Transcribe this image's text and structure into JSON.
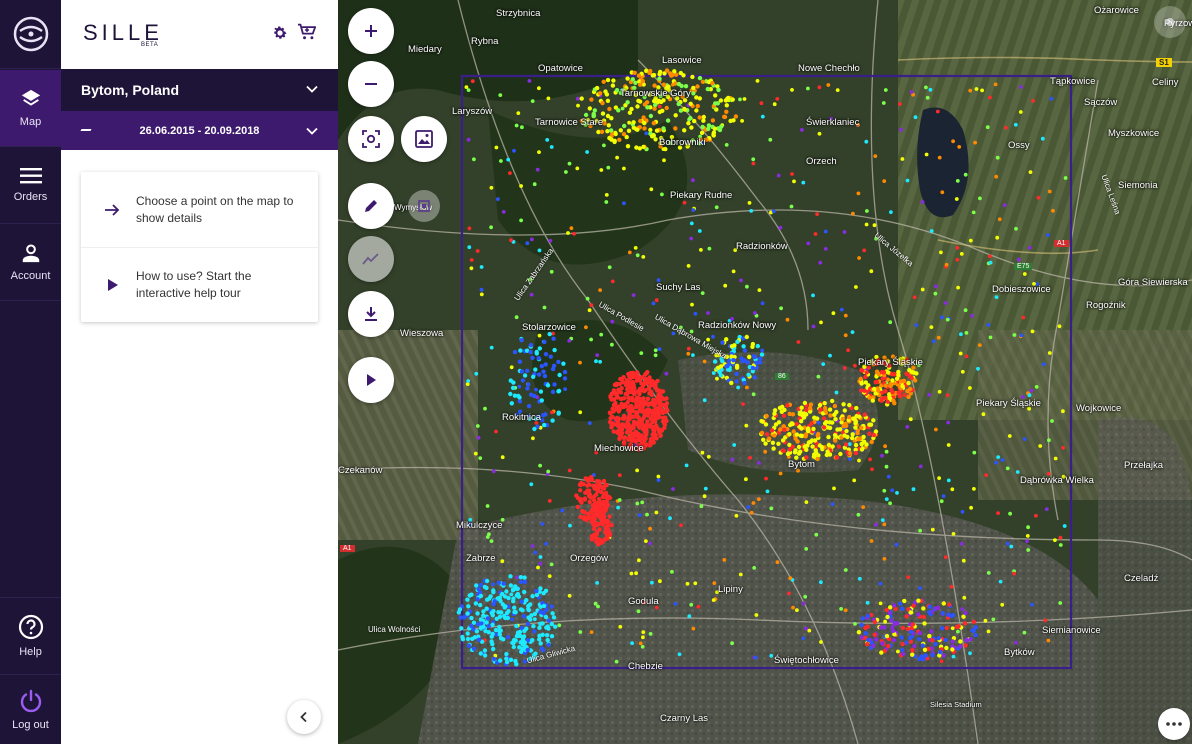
{
  "app": {
    "name": "SILLE",
    "badge": "BETA"
  },
  "nav": {
    "map": "Map",
    "orders": "Orders",
    "account": "Account",
    "help": "Help",
    "logout": "Log out"
  },
  "location": {
    "name": "Bytom, Poland"
  },
  "date_range": {
    "value": "26.06.2015 - 20.09.2018"
  },
  "cards": [
    {
      "text": "Choose a point on the map to show details",
      "icon": "arrow-right-icon"
    },
    {
      "text": "How to use? Start the interactive help tour",
      "icon": "play-icon"
    }
  ],
  "map": {
    "place_labels": [
      "Strzybnica",
      "Rybna",
      "Miedary",
      "Lasowice",
      "Nowe Chechło",
      "Opatowice",
      "Laryszów",
      "Tarnowskie Góry",
      "Tarnowice Stare",
      "Bobrowniki",
      "Świerklaniec",
      "Orzech",
      "Piekary Rudne",
      "Radzionków",
      "Suchy Las",
      "Stolarzowice",
      "Radzionków Nowy",
      "Piekary Śląskie",
      "Rokitnica",
      "Miechowice",
      "Bytom",
      "Zabrze",
      "Orzegów",
      "Godula",
      "Lipiny",
      "Chebzie",
      "Świętochłowice",
      "Bytków",
      "Siemianowice",
      "Ossy",
      "Siemonia",
      "Myszkowice",
      "Sączów",
      "Tąpkowice",
      "Ożarowice",
      "Celiny",
      "Dobieszowice",
      "Rogoźnik",
      "Góra Siewierska",
      "Wojkowice",
      "Piekary Śląskie",
      "Przełajka",
      "Dąbrówka Wielka",
      "Czeladź",
      "Wieszowa",
      "Czekanów",
      "Mikulczyce",
      "Czarny Las",
      "Silesia Stadium",
      "Pyrzow",
      "Wymysłów"
    ],
    "road_labels": [
      "Ulica Wolności",
      "Ulica Zabrzańska",
      "Ulica Dąbrowa Miejska",
      "Ulica Podlesie",
      "Ulica Józefka",
      "Ulica Leśna",
      "Ulica Gliwicka"
    ],
    "road_badges": [
      "S1",
      "A1",
      "E75",
      "A1",
      "86"
    ],
    "point_colors": {
      "red": "#ff2a2a",
      "orange": "#ff8a00",
      "yellow": "#f2ff00",
      "green": "#7cff4a",
      "cyan": "#1de9ff",
      "blue": "#2b55ff",
      "purple": "#8a2be2"
    },
    "aoi_color": "#3a1f8a"
  },
  "controls": {
    "zoom_in": "plus-icon",
    "zoom_out": "minus-icon",
    "fit_extent": "focus-icon",
    "basemap": "image-icon",
    "draw": "pencil-icon",
    "pick": "crop-icon",
    "chart": "trend-icon",
    "download": "download-icon",
    "play": "play-icon",
    "more": "more-icon"
  }
}
